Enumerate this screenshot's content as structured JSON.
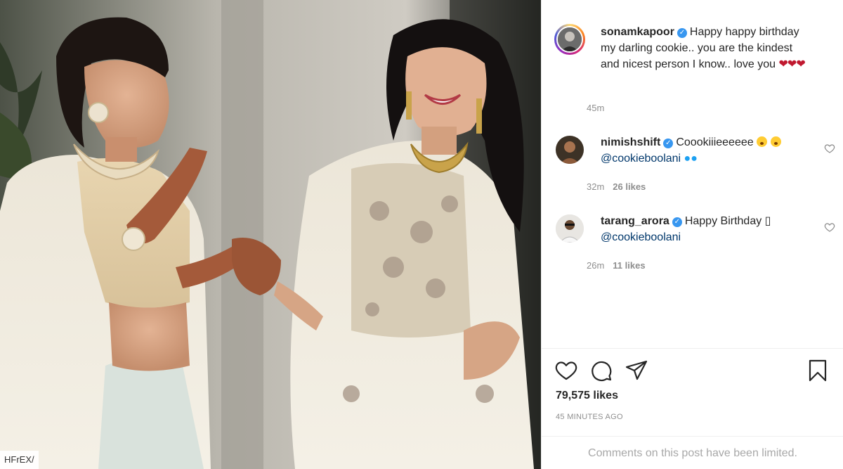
{
  "photo": {
    "watermark": "HFrEX/"
  },
  "post": {
    "author": {
      "username": "sonamkapoor",
      "verified": true,
      "caption": "Happy happy birthday my darling cookie.. you are the kindest and nicest person I know.. love you",
      "caption_hearts": "❤❤❤",
      "time": "45m"
    },
    "comments": [
      {
        "username": "nimishshift",
        "verified": true,
        "text": "Coookiiieeeeee",
        "mention": "@cookieboolani",
        "time": "32m",
        "likes": "26 likes"
      },
      {
        "username": "tarang_arora",
        "verified": true,
        "text": "Happy Birthday",
        "trailing_glyph": "▯",
        "mention": "@cookieboolani",
        "time": "26m",
        "likes": "11 likes"
      }
    ],
    "actions": {
      "like_icon": "heart-icon",
      "comment_icon": "comment-bubble-icon",
      "share_icon": "paper-plane-icon",
      "save_icon": "bookmark-icon"
    },
    "likes_count": "79,575 likes",
    "posted_ago": "45 MINUTES AGO",
    "comments_limited": "Comments on this post have been limited."
  },
  "colors": {
    "verified": "#3897f0",
    "mention": "#00376b",
    "muted": "#8e8e8e"
  }
}
